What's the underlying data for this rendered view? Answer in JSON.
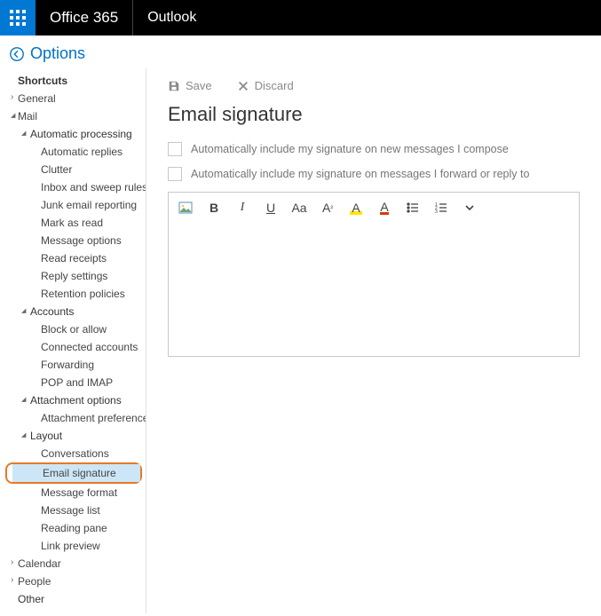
{
  "header": {
    "brand": "Office 365",
    "app": "Outlook"
  },
  "back": {
    "label": "Options"
  },
  "sidebar": {
    "shortcuts": "Shortcuts",
    "general": "General",
    "mail": "Mail",
    "autoproc": "Automatic processing",
    "auto_replies": "Automatic replies",
    "clutter": "Clutter",
    "inbox_rules": "Inbox and sweep rules",
    "junk": "Junk email reporting",
    "mark_read": "Mark as read",
    "msg_opts": "Message options",
    "read_rec": "Read receipts",
    "reply_set": "Reply settings",
    "retention": "Retention policies",
    "accounts": "Accounts",
    "block": "Block or allow",
    "connected": "Connected accounts",
    "forwarding": "Forwarding",
    "pop": "POP and IMAP",
    "attach_opts": "Attachment options",
    "attach_prefs": "Attachment preferences",
    "layout": "Layout",
    "conversations": "Conversations",
    "email_sig": "Email signature",
    "msg_format": "Message format",
    "msg_list": "Message list",
    "reading_pane": "Reading pane",
    "link_preview": "Link preview",
    "calendar": "Calendar",
    "people": "People",
    "other": "Other"
  },
  "page": {
    "save": "Save",
    "discard": "Discard",
    "title": "Email signature",
    "chk1": "Automatically include my signature on new messages I compose",
    "chk2": "Automatically include my signature on messages I forward or reply to",
    "tb": {
      "bold": "B",
      "italic": "I",
      "underline": "U",
      "size": "Aa",
      "sup": "A",
      "highlight": "A",
      "color": "A"
    }
  }
}
